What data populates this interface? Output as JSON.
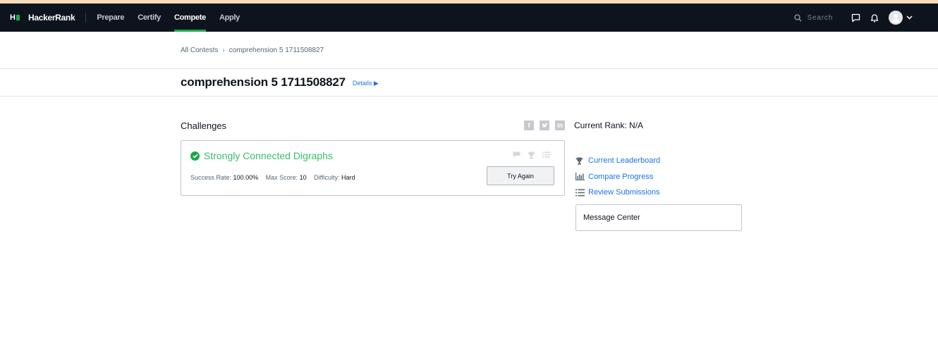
{
  "nav": {
    "logo_text": "HackerRank",
    "links": [
      {
        "label": "Prepare"
      },
      {
        "label": "Certify"
      },
      {
        "label": "Compete"
      },
      {
        "label": "Apply"
      }
    ],
    "search_placeholder": "Search"
  },
  "breadcrumb": {
    "root": "All Contests",
    "current": "comprehension 5 1711508827"
  },
  "header": {
    "title": "comprehension 5 1711508827",
    "details_link": "Details ▶"
  },
  "challenges": {
    "section_label": "Challenges",
    "items": [
      {
        "title": "Strongly Connected Digraphs",
        "success_rate_label": "Success Rate:",
        "success_rate": "100.00%",
        "max_score_label": "Max Score:",
        "max_score": "10",
        "difficulty_label": "Difficulty:",
        "difficulty": "Hard",
        "action_label": "Try Again"
      }
    ]
  },
  "sidebar": {
    "rank_label": "Current Rank: N/A",
    "links": [
      {
        "label": "Current Leaderboard",
        "icon": "trophy-icon"
      },
      {
        "label": "Compare Progress",
        "icon": "bar-chart-icon"
      },
      {
        "label": "Review Submissions",
        "icon": "list-icon"
      }
    ],
    "message_center": "Message Center"
  },
  "colors": {
    "nav_bg": "#0e141e",
    "accent_green": "#1ba94c",
    "link_blue": "#1a73e8",
    "solved_green": "#39c06b"
  }
}
